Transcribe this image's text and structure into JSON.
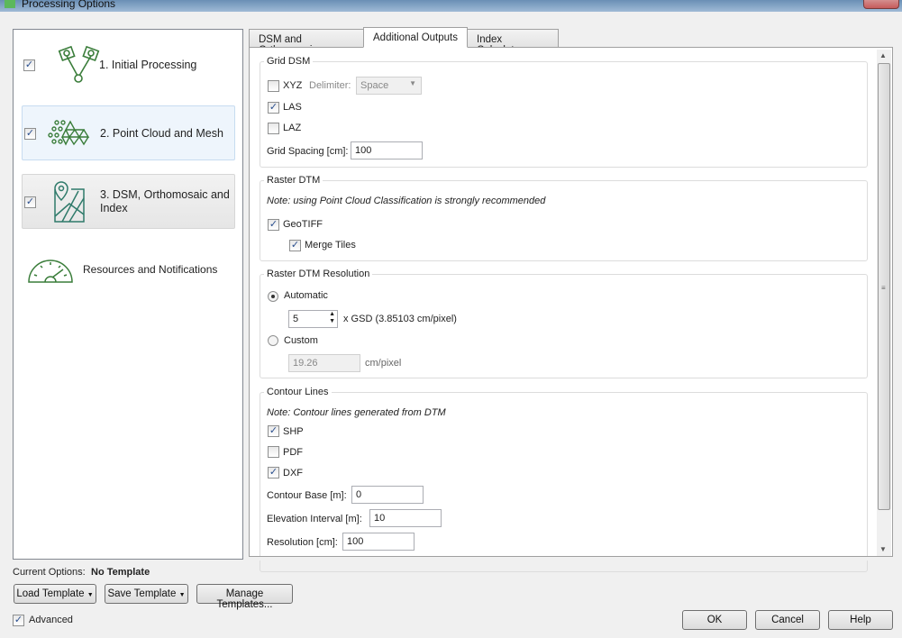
{
  "window": {
    "title": "Processing Options"
  },
  "sidebar": {
    "items": [
      {
        "label": "1. Initial Processing",
        "checked": true,
        "icon": "cameras-icon"
      },
      {
        "label": "2. Point Cloud and Mesh",
        "checked": true,
        "icon": "point-cloud-icon",
        "selected": true
      },
      {
        "label": "3. DSM, Orthomosaic and Index",
        "checked": true,
        "icon": "map-pin-icon"
      },
      {
        "label": "Resources and Notifications",
        "icon": "gauge-icon"
      }
    ]
  },
  "tabs": [
    {
      "label": "DSM and Orthomosaic"
    },
    {
      "label": "Additional Outputs",
      "active": true
    },
    {
      "label": "Index Calculator"
    }
  ],
  "grid_dsm": {
    "title": "Grid DSM",
    "xyz": {
      "label": "XYZ",
      "checked": false
    },
    "delimiter_label": "Delimiter:",
    "delimiter_value": "Space",
    "las": {
      "label": "LAS",
      "checked": true
    },
    "laz": {
      "label": "LAZ",
      "checked": false
    },
    "spacing_label": "Grid Spacing [cm]:",
    "spacing_value": "100"
  },
  "raster_dtm": {
    "title": "Raster DTM",
    "note": "Note: using Point Cloud Classification is strongly recommended",
    "geotiff": {
      "label": "GeoTIFF",
      "checked": true
    },
    "merge": {
      "label": "Merge Tiles",
      "checked": true
    }
  },
  "dtm_resolution": {
    "title": "Raster DTM Resolution",
    "automatic": {
      "label": "Automatic",
      "selected": true
    },
    "gsd_value": "5",
    "gsd_label": "x GSD (3.85103 cm/pixel)",
    "custom": {
      "label": "Custom",
      "selected": false
    },
    "custom_value": "19.26",
    "custom_unit": "cm/pixel"
  },
  "contour": {
    "title": "Contour Lines",
    "note": "Note: Contour lines generated from DTM",
    "shp": {
      "label": "SHP",
      "checked": true
    },
    "pdf": {
      "label": "PDF",
      "checked": false
    },
    "dxf": {
      "label": "DXF",
      "checked": true
    },
    "base_label": "Contour Base [m]:",
    "base_value": "0",
    "interval_label": "Elevation Interval [m]:",
    "interval_value": "10",
    "resolution_label": "Resolution [cm]:",
    "resolution_value": "100"
  },
  "footer": {
    "current_label": "Current Options:",
    "current_value": "No Template",
    "load": "Load Template",
    "save": "Save Template",
    "manage": "Manage Templates...",
    "advanced": "Advanced",
    "advanced_checked": true,
    "ok": "OK",
    "cancel": "Cancel",
    "help": "Help"
  },
  "colors": {
    "icon_green": "#3a7d3a",
    "accent": "#c7dcf0"
  }
}
